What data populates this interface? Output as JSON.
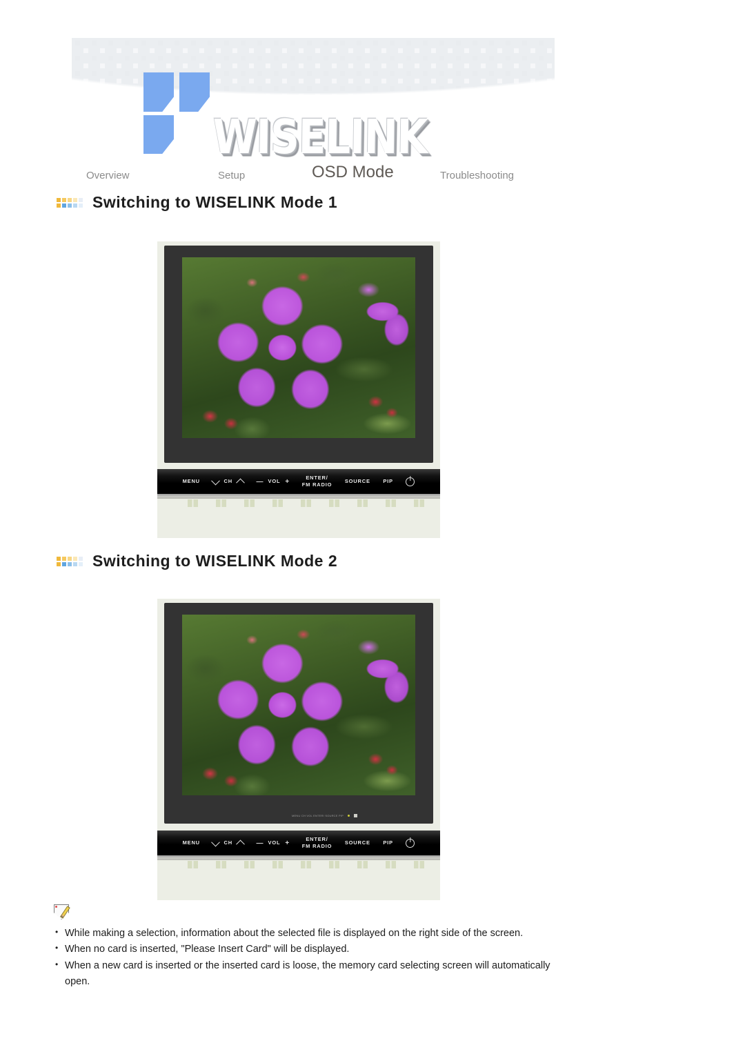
{
  "header": {
    "logo_text": "WISELINK",
    "logo_mark_color": "#7aa9ef",
    "dot_pattern_color": "#e9ecef"
  },
  "nav": {
    "items": [
      {
        "label": "Overview",
        "active": false
      },
      {
        "label": "Setup",
        "active": false
      },
      {
        "label": "OSD Mode",
        "active": true
      },
      {
        "label": "Troubleshooting",
        "active": false
      }
    ]
  },
  "sections": [
    {
      "bullet_icon": "color-grid-bullet-icon",
      "title": "Switching to WISELINK Mode 1",
      "figure": {
        "name": "monitor-wiselink-mode-1",
        "screen_content": "purple tibouchina flower photo on green foliage",
        "has_mini_strip": false,
        "controls": [
          {
            "name": "menu",
            "label": "MENU"
          },
          {
            "name": "channel",
            "label": "CH",
            "left_icon": "chevron-down-icon",
            "right_icon": "chevron-up-icon"
          },
          {
            "name": "volume",
            "label": "VOL",
            "left_icon": "minus-icon",
            "right_icon": "plus-icon"
          },
          {
            "name": "enter-fm-radio",
            "label": "ENTER/\nFM RADIO"
          },
          {
            "name": "source",
            "label": "SOURCE"
          },
          {
            "name": "pip",
            "label": "PIP"
          },
          {
            "name": "power",
            "label": "",
            "icon": "power-icon"
          }
        ]
      }
    },
    {
      "bullet_icon": "color-grid-bullet-icon",
      "title": "Switching to WISELINK Mode 2",
      "figure": {
        "name": "monitor-wiselink-mode-2",
        "screen_content": "purple tibouchina flower photo on green foliage",
        "has_mini_strip": true,
        "mini_strip_text": "MENU  CH   VOL  ENTER/ SOURCE  PIP",
        "controls": [
          {
            "name": "menu",
            "label": "MENU"
          },
          {
            "name": "channel",
            "label": "CH",
            "left_icon": "chevron-down-icon",
            "right_icon": "chevron-up-icon"
          },
          {
            "name": "volume",
            "label": "VOL",
            "left_icon": "minus-icon",
            "right_icon": "plus-icon"
          },
          {
            "name": "enter-fm-radio",
            "label": "ENTER/\nFM RADIO"
          },
          {
            "name": "source",
            "label": "SOURCE"
          },
          {
            "name": "pip",
            "label": "PIP"
          },
          {
            "name": "power",
            "label": "",
            "icon": "power-icon"
          }
        ]
      }
    }
  ],
  "controls_text": {
    "menu": "MENU",
    "ch": "CH",
    "vol": "VOL",
    "enter_line1": "ENTER/",
    "enter_line2": "FM RADIO",
    "source": "SOURCE",
    "pip": "PIP",
    "minus": "—",
    "plus": "+"
  },
  "notes": {
    "icon": "note-pencil-icon",
    "items": [
      "While making a selection, information about the selected file is displayed on the right side of the screen.",
      "When no card is inserted, \"Please Insert Card\" will be displayed.",
      "When a new card is inserted or the inserted card is loose, the memory card selecting screen will automatically open."
    ]
  },
  "colors": {
    "accent_blue": "#7aa9ef",
    "bullet_orange": "#f0b93c",
    "bullet_blue": "#5fa5e0",
    "bezel": "#333333",
    "chassis": "#eceee5",
    "heading": "#1d1d1d",
    "nav_inactive": "#8b8b8b",
    "nav_active": "#5f5a55"
  }
}
